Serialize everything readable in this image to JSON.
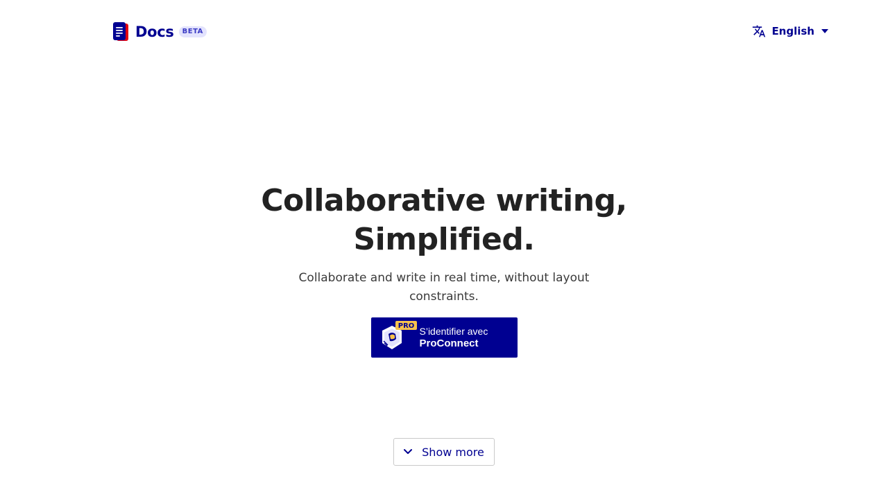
{
  "header": {
    "brand_name": "Docs",
    "beta_badge": "BETA",
    "language": {
      "selected": "English",
      "icon": "translate-icon"
    }
  },
  "hero": {
    "title": "Collaborative writing, Simplified.",
    "subtitle": "Collaborate and write in real time, without layout constraints.",
    "login_button": {
      "pro_badge": "PRO",
      "line1": "S’identifier avec",
      "line2": "ProConnect"
    }
  },
  "show_more": {
    "label": "Show more",
    "icon": "chevron-down-icon"
  },
  "colors": {
    "brand_blue": "#000091",
    "beta_bg": "#e3e3fd",
    "pro_badge": "#f7c24d",
    "text": "#222222"
  }
}
